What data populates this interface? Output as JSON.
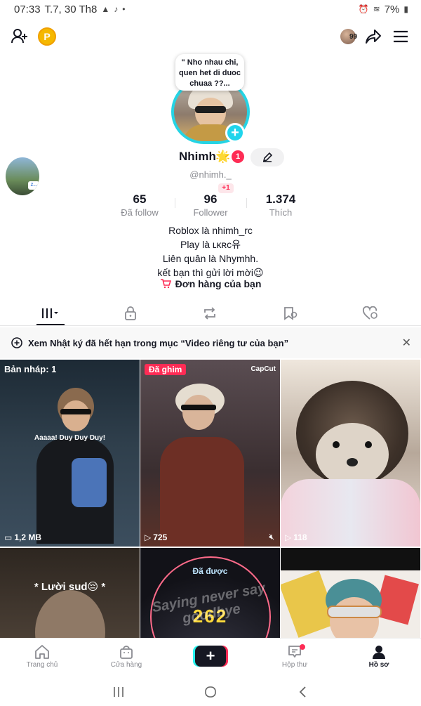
{
  "status_bar": {
    "time": "07:33",
    "date": "T.7, 30 Th8",
    "battery": "7%"
  },
  "profile": {
    "note": "\" Nho nhau chi, quen het di duoc chuaa ??...",
    "username": "Nhimh",
    "name_emoji": "🌟",
    "badge_count": "1",
    "handle": "@nhimh._",
    "follower_increase": "+1",
    "side_tag": "Z..."
  },
  "stats": [
    {
      "value": "65",
      "label": "Đã follow"
    },
    {
      "value": "96",
      "label": "Follower"
    },
    {
      "value": "1.374",
      "label": "Thích"
    }
  ],
  "bio": {
    "line1": "Roblox là nhimh_rc",
    "line2": "Play là ʟᴋʀᴄ유",
    "line3": "Liên quân là Nhymhh.",
    "line4": "kết bạn thì gửi lời mời😉"
  },
  "orders_label": "Đơn hàng của bạn",
  "banner": {
    "text": "Xem Nhật ký đã hết hạn trong mục “Video riêng tư của bạn”"
  },
  "grid": {
    "drafts_label": "Bản nháp: 1",
    "drafts_size": "1,2 MB",
    "drafts_caption": "Aaaaa! Duy Duy Duy!",
    "pinned_label": "Đã ghim",
    "capcut_label": "CapCut",
    "v2_views": "725",
    "v3_views": "118",
    "v4_caption": "* Lười sud😔 *",
    "v5_top": "Đã được",
    "v5_number": "262",
    "v5_art": "Saying never say goodbye"
  },
  "bottom_nav": {
    "home": "Trang chủ",
    "shop": "Cửa hàng",
    "post": "+",
    "inbox": "Hộp thư",
    "profile": "Hồ sơ"
  },
  "colors": {
    "accent_pink": "#fe2c55",
    "accent_cyan": "#25d4e4",
    "text_primary": "#161823",
    "text_secondary": "#8a8b91"
  }
}
